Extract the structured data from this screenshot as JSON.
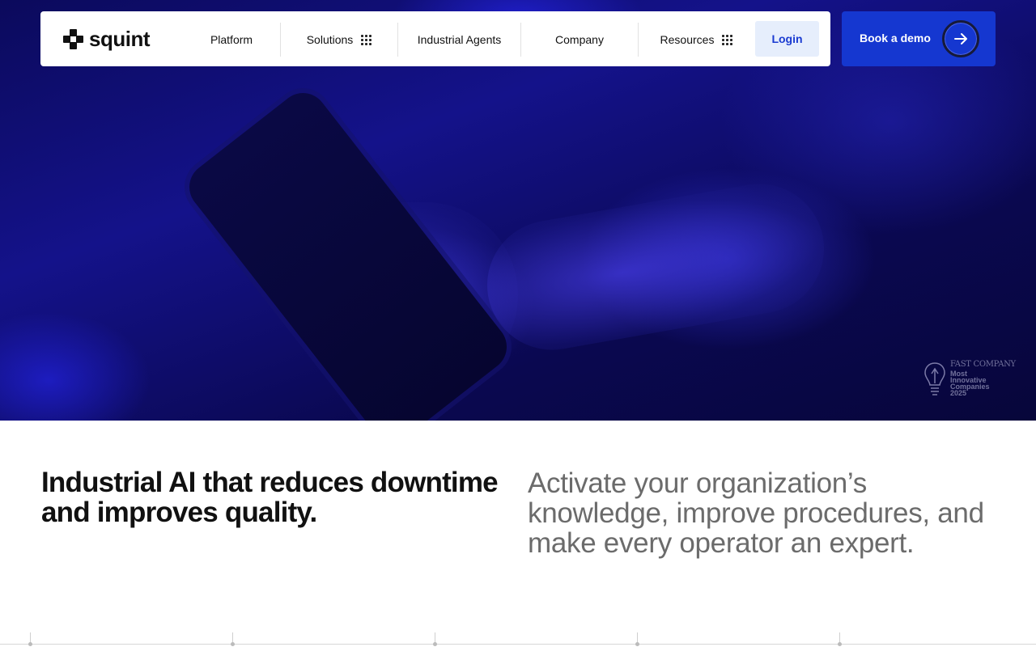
{
  "brand": {
    "name": "squint"
  },
  "nav": {
    "items": [
      {
        "label": "Platform",
        "has_menu": false
      },
      {
        "label": "Solutions",
        "has_menu": true
      },
      {
        "label": "Industrial Agents",
        "has_menu": false
      },
      {
        "label": "Company",
        "has_menu": false
      },
      {
        "label": "Resources",
        "has_menu": true
      }
    ],
    "login_label": "Login",
    "cta_label": "Book a demo"
  },
  "hero": {
    "badge": {
      "brand": "FAST COMPANY",
      "lines": [
        "Most",
        "Innovative",
        "Companies",
        "2025"
      ]
    }
  },
  "content": {
    "headline": "Industrial AI that reduces downtime and improves quality.",
    "subhead": "Activate your organization’s knowledge, improve procedures, and make every operator an expert."
  },
  "colors": {
    "accent": "#1537d0",
    "login_bg": "#e6eefc",
    "login_text": "#1a3bd1",
    "subhead_text": "#6b6b6b"
  }
}
